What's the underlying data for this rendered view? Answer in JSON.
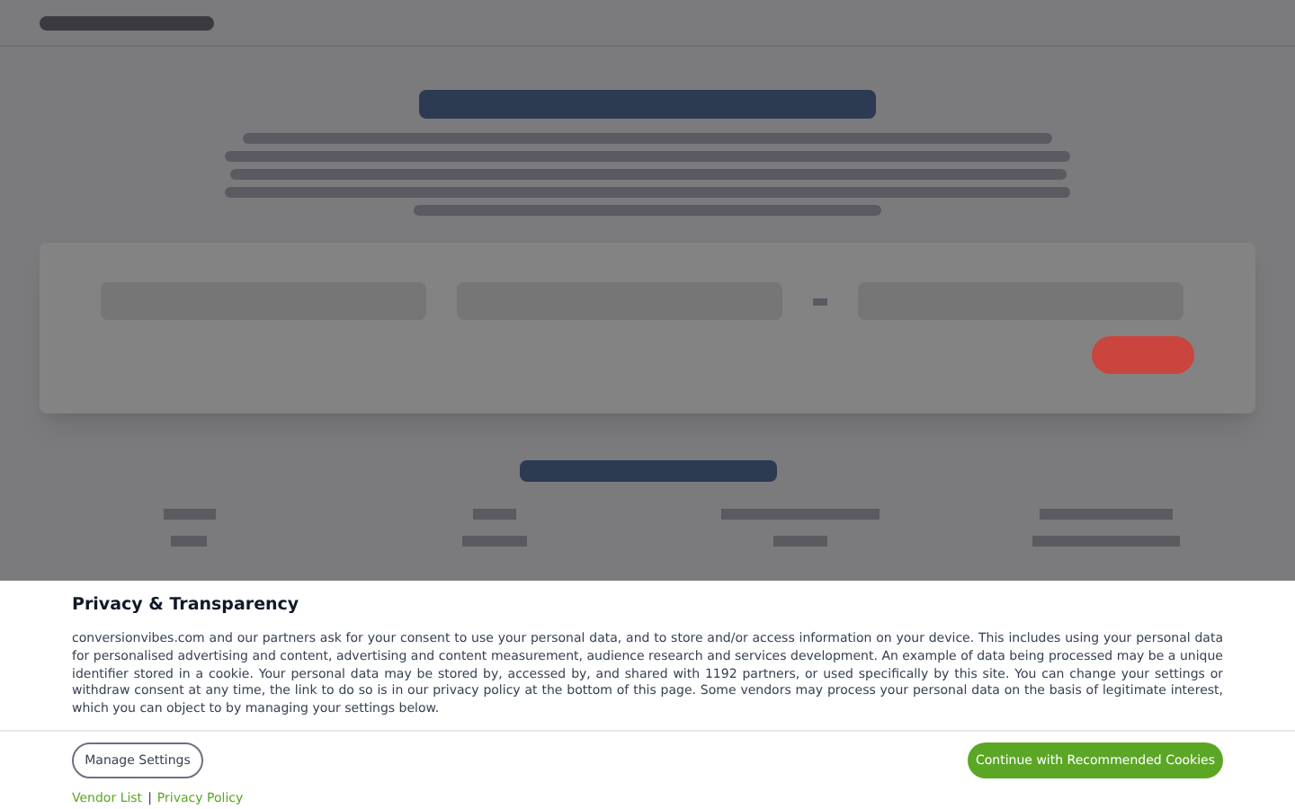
{
  "consent": {
    "title": "Privacy & Transparency",
    "body": "conversionvibes.com and our partners ask for your consent to use your personal data, and to store and/or access information on your device. This includes using your personal data for personalised advertising and content, advertising and content measurement, audience research and services development. An example of data being processed may be a unique identifier stored in a cookie. Your personal data may be stored by, accessed by, and shared with 1192 partners, or used specifically by this site. You can change your settings or withdraw consent at any time, the link to do so is in our privacy policy at the bottom of this page. Some vendors may process your personal data on the basis of legitimate interest, which you can object to by managing your settings below.",
    "manage": "Manage Settings",
    "accept": "Continue with Recommended Cookies",
    "links": [
      "Vendor List",
      "|",
      "Privacy Policy"
    ]
  }
}
